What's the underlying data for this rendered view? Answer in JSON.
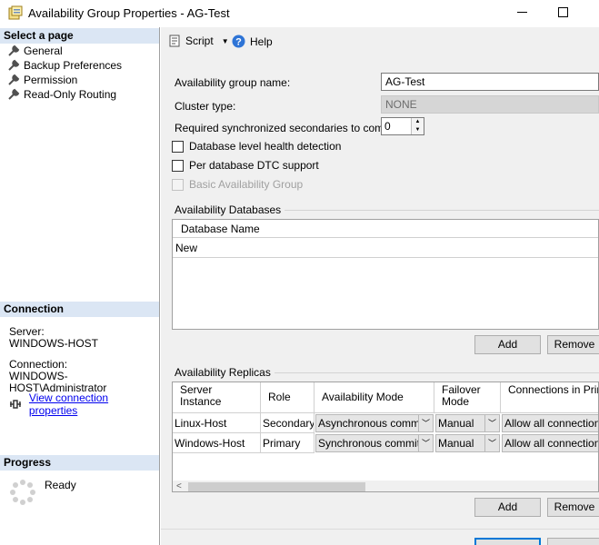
{
  "window": {
    "title": "Availability Group Properties - AG-Test"
  },
  "left": {
    "select_page_header": "Select a page",
    "pages": [
      {
        "label": "General"
      },
      {
        "label": "Backup Preferences"
      },
      {
        "label": "Permission"
      },
      {
        "label": "Read-Only Routing"
      }
    ],
    "connection_header": "Connection",
    "server_label": "Server:",
    "server_value": "WINDOWS-HOST",
    "connection_label": "Connection:",
    "connection_value": "WINDOWS-HOST\\Administrator",
    "view_connection_link": "View connection properties",
    "progress_header": "Progress",
    "progress_status": "Ready"
  },
  "toolbar": {
    "script_label": "Script",
    "help_label": "Help"
  },
  "form": {
    "ag_name_label": "Availability group name:",
    "ag_name_value": "AG-Test",
    "cluster_type_label": "Cluster type:",
    "cluster_type_value": "NONE",
    "req_sync_label": "Required synchronized secondaries to commit:",
    "req_sync_value": "0",
    "db_health_label": "Database level health detection",
    "dtc_label": "Per database DTC support",
    "basic_ag_label": "Basic Availability Group"
  },
  "availability_databases": {
    "title": "Availability Databases",
    "column_header": "Database Name",
    "rows": [
      {
        "name": "New"
      }
    ],
    "add_button": "Add",
    "remove_button": "Remove"
  },
  "availability_replicas": {
    "title": "Availability Replicas",
    "headers": {
      "server_instance": "Server Instance",
      "role": "Role",
      "availability_mode": "Availability Mode",
      "failover_mode": "Failover Mode",
      "connections": "Connections in Primary Role"
    },
    "rows": [
      {
        "server": "Linux-Host",
        "role": "Secondary",
        "mode": "Asynchronous commit",
        "failover": "Manual",
        "connections": "Allow all connections"
      },
      {
        "server": "Windows-Host",
        "role": "Primary",
        "mode": "Synchronous commit",
        "failover": "Manual",
        "connections": "Allow all connections"
      }
    ],
    "add_button": "Add",
    "remove_button": "Remove"
  },
  "colors": {
    "section_header_bg": "#dbe6f4",
    "link": "#0000ee",
    "dialog_bg": "#f0f0f0"
  }
}
